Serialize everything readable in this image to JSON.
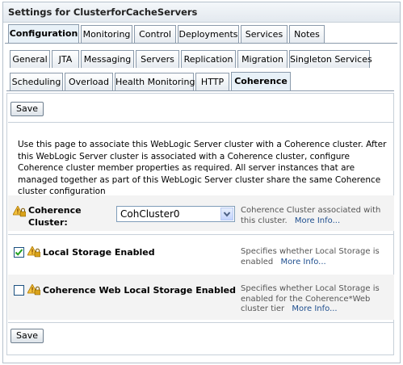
{
  "header": {
    "title": "Settings for ClusterforCacheServers"
  },
  "tabs_level1": [
    {
      "label": "Configuration",
      "active": true
    },
    {
      "label": "Monitoring",
      "active": false
    },
    {
      "label": "Control",
      "active": false
    },
    {
      "label": "Deployments",
      "active": false
    },
    {
      "label": "Services",
      "active": false
    },
    {
      "label": "Notes",
      "active": false
    }
  ],
  "tabs_level2": [
    {
      "label": "General"
    },
    {
      "label": "JTA"
    },
    {
      "label": "Messaging"
    },
    {
      "label": "Servers"
    },
    {
      "label": "Replication"
    },
    {
      "label": "Migration"
    },
    {
      "label": "Singleton Services"
    }
  ],
  "tabs_level3": [
    {
      "label": "Scheduling",
      "active": false
    },
    {
      "label": "Overload",
      "active": false
    },
    {
      "label": "Health Monitoring",
      "active": false
    },
    {
      "label": "HTTP",
      "active": false
    },
    {
      "label": "Coherence",
      "active": true
    }
  ],
  "buttons": {
    "save_top": "Save",
    "save_bottom": "Save"
  },
  "intro_text": "Use this page to associate this WebLogic Server cluster with a Coherence cluster. After this WebLogic Server cluster is associated with a Coherence cluster, configure Coherence cluster member properties as required. All server instances that are managed together as part of this WebLogic Server cluster share the same Coherence cluster configuration",
  "fields": {
    "coherence_cluster": {
      "label_line1": "Coherence",
      "label_line2": "Cluster:",
      "value": "CohCluster0",
      "help": "Coherence Cluster associated with this cluster.",
      "more_info": "More Info..."
    },
    "local_storage": {
      "label": "Local Storage Enabled",
      "checked": true,
      "help": "Specifies whether Local Storage is enabled",
      "more_info": "More Info..."
    },
    "web_local_storage": {
      "label": "Coherence Web Local Storage Enabled",
      "checked": false,
      "help": "Specifies whether Local Storage is enabled for the Coherence*Web cluster tier",
      "more_info": "More Info..."
    }
  },
  "icons": {
    "field_icon": "warning-lock-icon",
    "select_arrow": "chevron-down-icon",
    "check": "checkmark-icon"
  },
  "colors": {
    "tab_border": "#8a9aab",
    "active_tab_bg": "#e8f1f8",
    "link": "#1f4f8f",
    "shade_row": "#f3f3f3"
  }
}
